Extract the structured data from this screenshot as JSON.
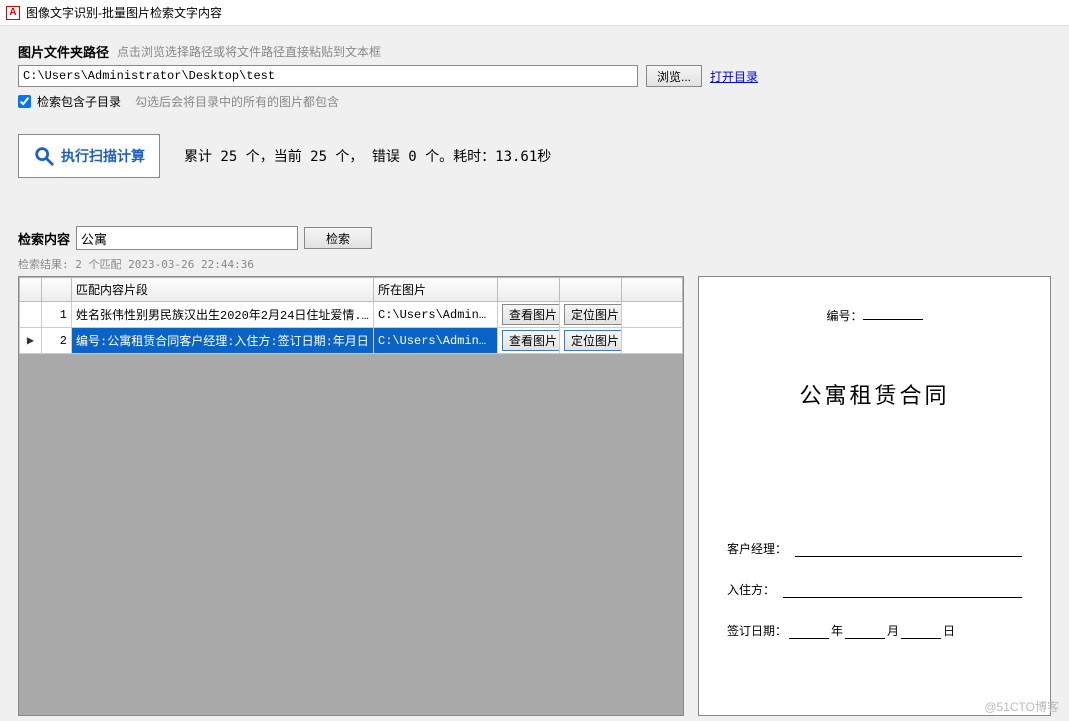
{
  "window": {
    "icon_letter": "A",
    "title": "图像文字识别-批量图片检索文字内容"
  },
  "path": {
    "label": "图片文件夹路径",
    "hint": "点击浏览选择路径或将文件路径直接粘贴到文本框",
    "value": "C:\\Users\\Administrator\\Desktop\\test",
    "browse": "浏览...",
    "open_dir": "打开目录"
  },
  "subdir": {
    "label": "检索包含子目录",
    "hint": "勾选后会将目录中的所有的图片都包含"
  },
  "scan": {
    "button": "执行扫描计算",
    "stats": "累计 25 个，当前 25 个， 错误 0 个。耗时：13.61秒"
  },
  "search": {
    "label": "检索内容",
    "value": "公寓",
    "button": "检索"
  },
  "results": {
    "meta": "检索结果: 2 个匹配 2023-03-26 22:44:36",
    "columns": {
      "blank": "",
      "num": "",
      "fragment": "匹配内容片段",
      "image": "所在图片",
      "view": "",
      "locate": ""
    },
    "view_label": "查看图片",
    "locate_label": "定位图片",
    "rows": [
      {
        "indicator": "",
        "num": "1",
        "fragment": "姓名张伟性别男民族汉出生2020年2月24日住址爱情...",
        "image": "C:\\Users\\Adminis...",
        "selected": false
      },
      {
        "indicator": "▶",
        "num": "2",
        "fragment": "编号:公寓租赁合同客户经理:入住方:签订日期:年月日",
        "image": "C:\\Users\\Adminis...",
        "selected": true
      }
    ]
  },
  "preview": {
    "number_label": "编号：",
    "title": "公寓租赁合同",
    "manager_label": "客户经理：",
    "tenant_label": "入住方：",
    "date_label": "签订日期：",
    "date_year": "年",
    "date_month": "月",
    "date_day": "日"
  },
  "watermark": "@51CTO博客"
}
